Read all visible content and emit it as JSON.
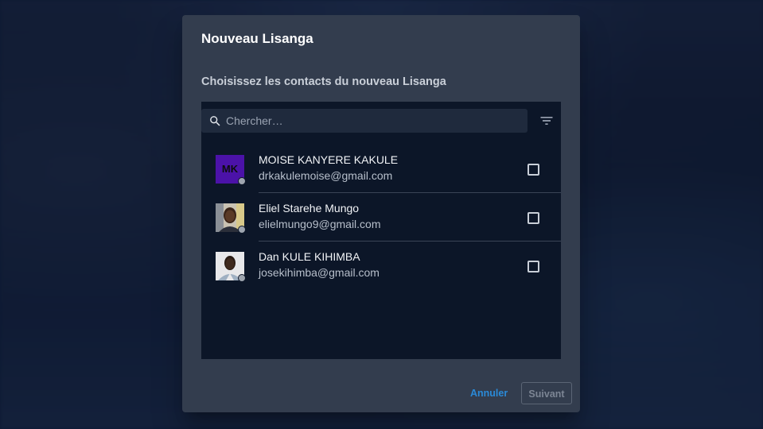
{
  "dialog": {
    "title": "Nouveau Lisanga",
    "subtitle": "Choisissez les contacts du nouveau Lisanga"
  },
  "search": {
    "placeholder": "Chercher…",
    "value": "",
    "icon": "search-icon",
    "filter_icon": "filter-icon"
  },
  "contacts": [
    {
      "name": "MOISE KANYERE KAKULE",
      "email": "drkakulemoise@gmail.com",
      "avatar_initials": "MK",
      "avatar_type": "initials",
      "avatar_color": "#4b12a8",
      "checked": false
    },
    {
      "name": "Eliel Starehe Mungo",
      "email": "elielmungo9@gmail.com",
      "avatar_initials": "",
      "avatar_type": "photo",
      "checked": false
    },
    {
      "name": "Dan KULE KIHIMBA",
      "email": "josekihimba@gmail.com",
      "avatar_initials": "",
      "avatar_type": "photo",
      "checked": false
    }
  ],
  "actions": {
    "cancel_label": "Annuler",
    "next_label": "Suivant",
    "next_disabled": true
  },
  "colors": {
    "accent": "#2a8ad8",
    "dialog_bg": "#333d4e",
    "panel_bg": "#0c1628"
  }
}
